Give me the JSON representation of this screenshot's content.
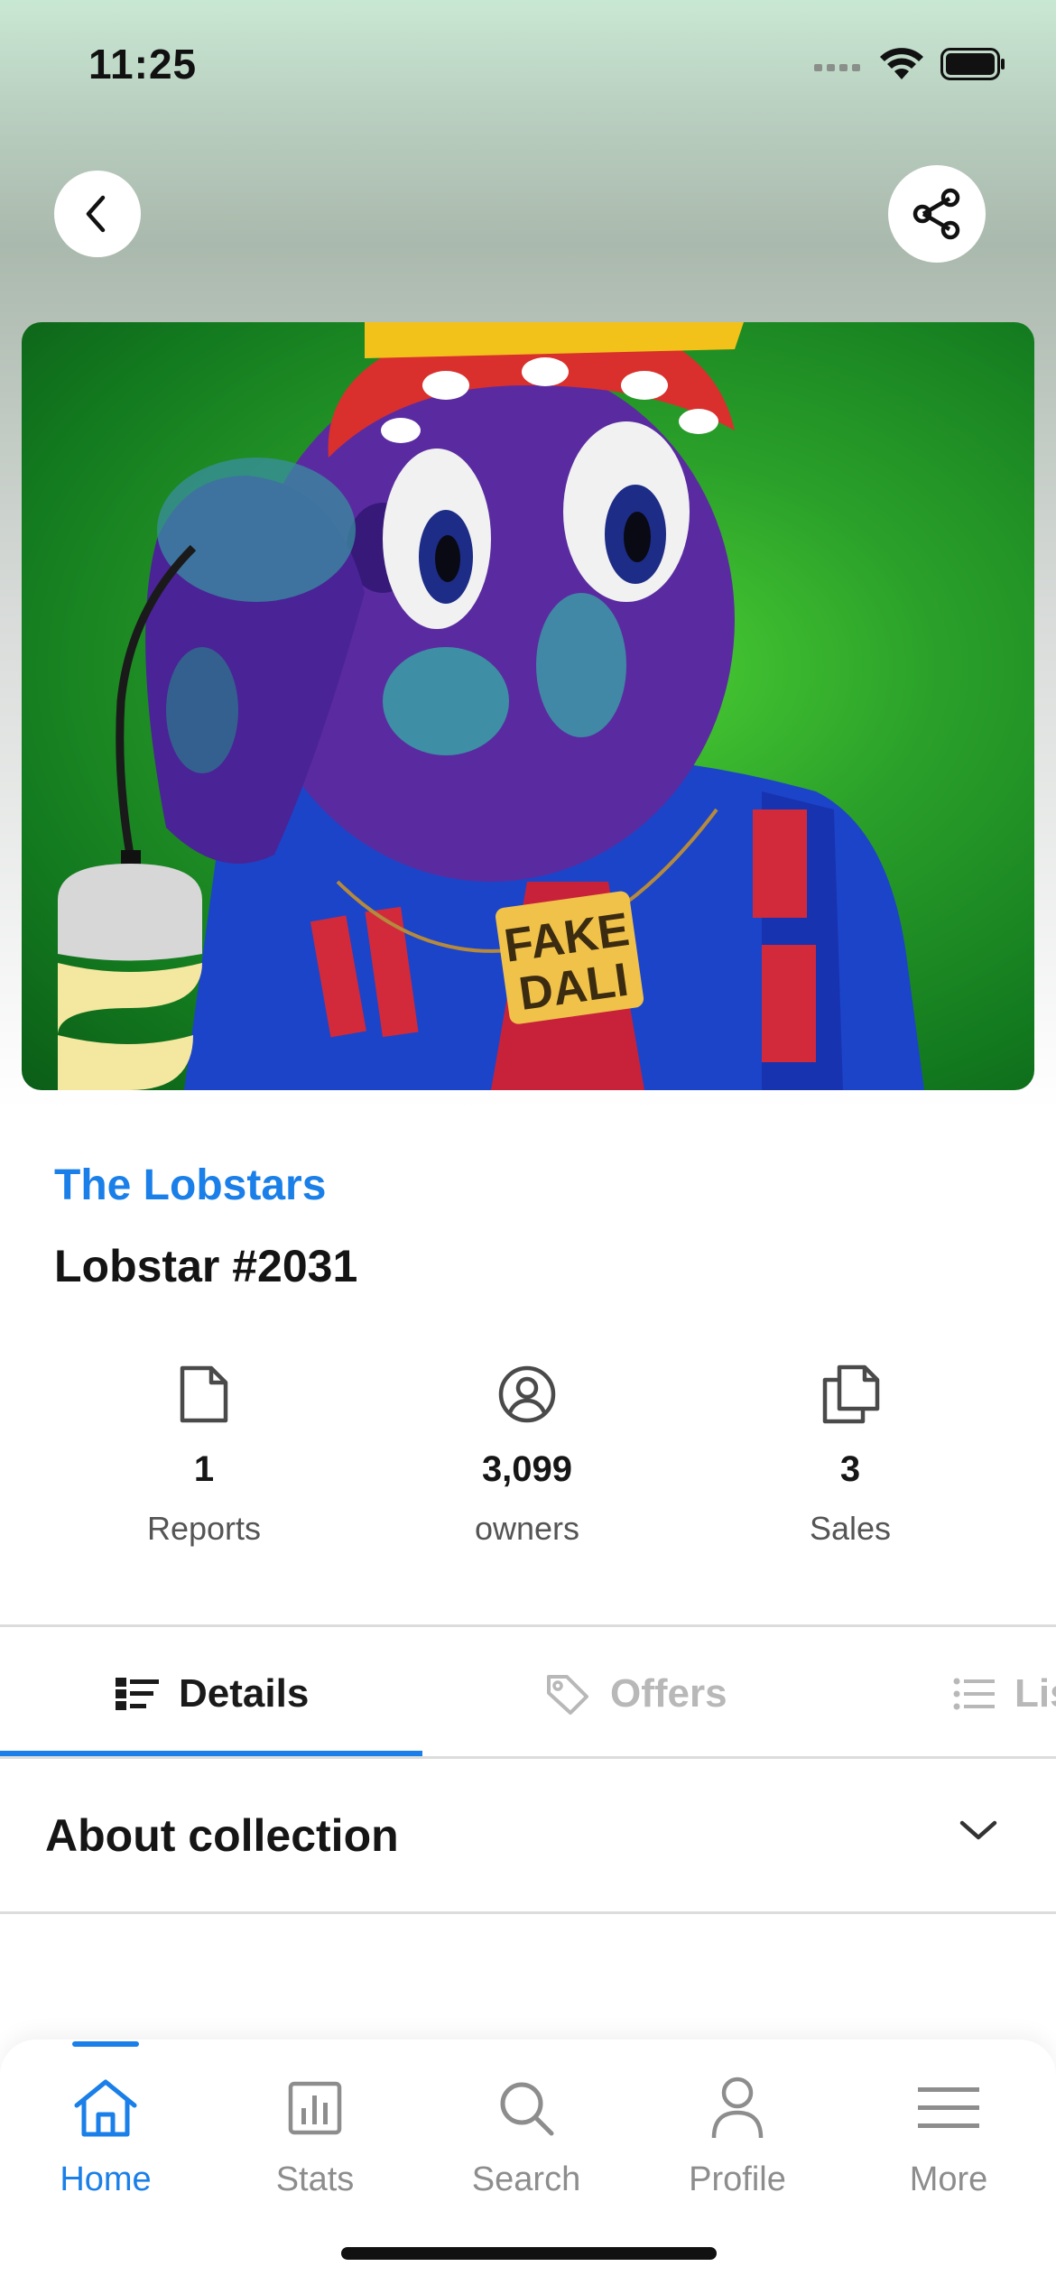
{
  "status_bar": {
    "time": "11:25"
  },
  "header": {
    "back_icon": "chevron-left-icon",
    "share_icon": "share-icon"
  },
  "nft": {
    "collection": "The Lobstars",
    "name": "Lobstar #2031",
    "art_text_line1": "FAKE",
    "art_text_line2": "DALI"
  },
  "stats": [
    {
      "icon": "document-icon",
      "value": "1",
      "label": "Reports"
    },
    {
      "icon": "user-circle-icon",
      "value": "3,099",
      "label": "owners"
    },
    {
      "icon": "copy-icon",
      "value": "3",
      "label": "Sales"
    }
  ],
  "tabs": [
    {
      "label": "Details",
      "icon": "details-list-icon",
      "active": true
    },
    {
      "label": "Offers",
      "icon": "tag-icon",
      "active": false
    },
    {
      "label": "Lis",
      "icon": "list-icon",
      "active": false
    }
  ],
  "accordion": {
    "title": "About collection"
  },
  "bottom_nav": [
    {
      "label": "Home",
      "icon": "home-icon",
      "active": true
    },
    {
      "label": "Stats",
      "icon": "stats-icon",
      "active": false
    },
    {
      "label": "Search",
      "icon": "search-icon",
      "active": false
    },
    {
      "label": "Profile",
      "icon": "profile-icon",
      "active": false
    },
    {
      "label": "More",
      "icon": "menu-icon",
      "active": false
    }
  ],
  "colors": {
    "accent": "#1a7fe8",
    "text_dark": "#141414",
    "text_muted": "#8d8d8d"
  }
}
